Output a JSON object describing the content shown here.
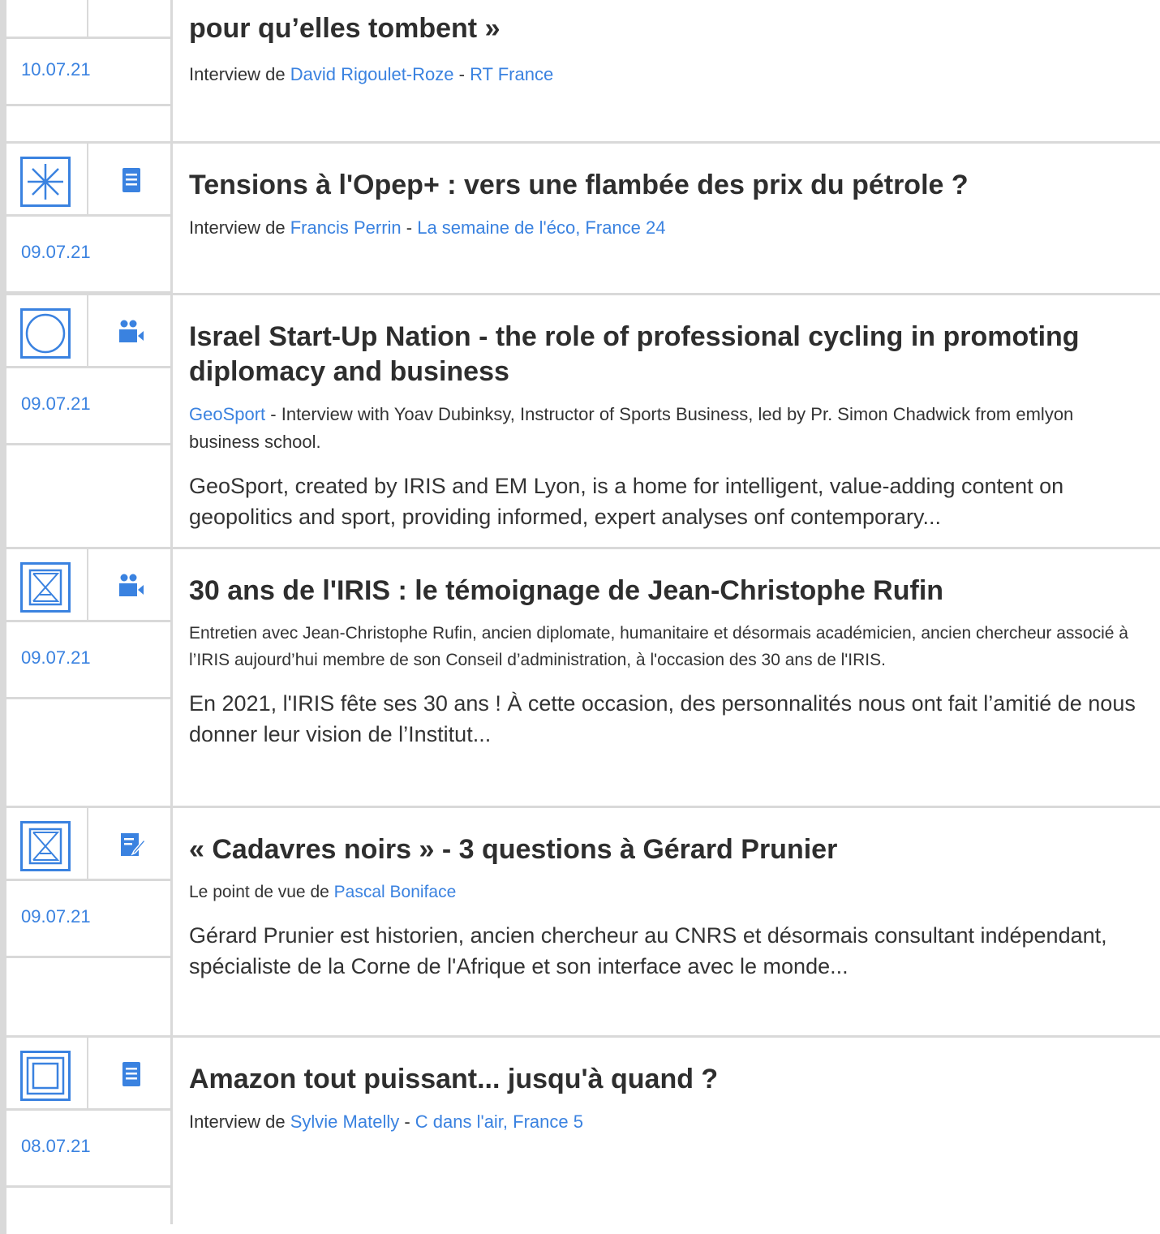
{
  "colors": {
    "accent": "#3a82e0",
    "rule": "#d9d9d9",
    "title": "#2e2e2e"
  },
  "articles": [
    {
      "title": "pour qu’elles tombent »",
      "date": "10.07.21",
      "meta_prefix": "Interview de ",
      "author": "David Rigoulet-Roze",
      "meta_sep": " - ",
      "source": "RT France",
      "theme_icon": "",
      "type_icon": ""
    },
    {
      "title": "Tensions à l'Opep+ : vers une flambée des prix du pétrole ?",
      "date": "09.07.21",
      "meta_prefix": "Interview de ",
      "author": "Francis Perrin",
      "meta_sep": " - ",
      "source": "La semaine de l'éco, France 24",
      "theme_icon": "asterisk-theme-icon",
      "type_icon": "document-icon"
    },
    {
      "title": "Israel Start-Up Nation - the role of professional cycling in promoting diplomacy and business",
      "date": "09.07.21",
      "meta_link": "GeoSport",
      "meta_text": " - Interview with Yoav Dubinksy, Instructor of Sports Business, led by Pr. Simon Chadwick from emlyon business school.",
      "summary": "GeoSport, created by IRIS and EM Lyon, is a home for intelligent, value-adding content on geopolitics and sport, providing informed, expert analyses onf contemporary...",
      "theme_icon": "circle-theme-icon",
      "type_icon": "video-icon"
    },
    {
      "title": "30 ans de l'IRIS : le témoignage de Jean-Christophe Rufin",
      "date": "09.07.21",
      "meta_text": "Entretien avec Jean-Christophe Rufin, ancien diplomate, humanitaire et désormais académicien, ancien chercheur associé à l’IRIS aujourd’hui membre de son Conseil d’administration, à l'occasion des 30 ans de l'IRIS.",
      "summary": "En 2021, l'IRIS fête ses 30 ans ! À cette occasion, des personnalités nous ont fait l’amitié de nous donner leur vision de l’Institut...",
      "theme_icon": "hourglass-theme-icon",
      "type_icon": "video-icon"
    },
    {
      "title": "« Cadavres noirs » - 3 questions à Gérard Prunier",
      "date": "09.07.21",
      "meta_prefix": "Le point de vue de ",
      "author": "Pascal Boniface",
      "summary": "Gérard Prunier est historien, ancien chercheur au CNRS et désormais consultant indépendant, spécialiste de la Corne de l'Afrique et son interface avec le monde...",
      "theme_icon": "hourglass-theme-icon",
      "type_icon": "edit-note-icon"
    },
    {
      "title": "Amazon tout puissant... jusqu'à quand ?",
      "date": "08.07.21",
      "meta_prefix": "Interview de ",
      "author": "Sylvie Matelly",
      "meta_sep": " - ",
      "source": "C dans l'air, France 5",
      "theme_icon": "nested-squares-theme-icon",
      "type_icon": "document-icon"
    }
  ]
}
